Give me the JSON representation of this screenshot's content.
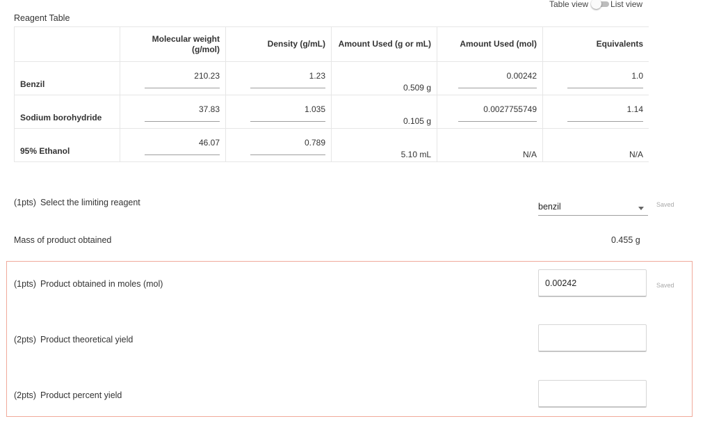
{
  "view_toggle": {
    "left_label": "Table view",
    "right_label": "List view"
  },
  "section_title": "Reagent Table",
  "table": {
    "headers": [
      "",
      "Molecular weight (g/mol)",
      "Density (g/mL)",
      "Amount Used (g or mL)",
      "Amount Used (mol)",
      "Equivalents"
    ],
    "rows": [
      {
        "name": "Benzil",
        "mw": "210.23",
        "density": "1.23",
        "amount": "0.509 g",
        "mol": "0.00242",
        "equiv": "1.0"
      },
      {
        "name": "Sodium borohydride",
        "mw": "37.83",
        "density": "1.035",
        "amount": "0.105 g",
        "mol": "0.0027755749",
        "equiv": "1.14"
      },
      {
        "name": "95% Ethanol",
        "mw": "46.07",
        "density": "0.789",
        "amount": "5.10 mL",
        "mol": "N/A",
        "equiv": "N/A"
      }
    ]
  },
  "limiting": {
    "pts": "(1pts)",
    "label": "Select the limiting reagent",
    "selected": "benzil",
    "status": "Saved"
  },
  "mass": {
    "label": "Mass of product obtained",
    "value": "0.455 g"
  },
  "moles": {
    "pts": "(1pts)",
    "label": "Product obtained in moles (mol)",
    "value": "0.00242",
    "status": "Saved"
  },
  "theoretical": {
    "pts": "(2pts)",
    "label": "Product theoretical yield",
    "value": ""
  },
  "percent": {
    "pts": "(2pts)",
    "label": "Product percent yield",
    "value": ""
  },
  "colors": {
    "error_border": "#f0a99a",
    "underline": "#9e9e9e",
    "saved_text": "#a8a8a8"
  }
}
